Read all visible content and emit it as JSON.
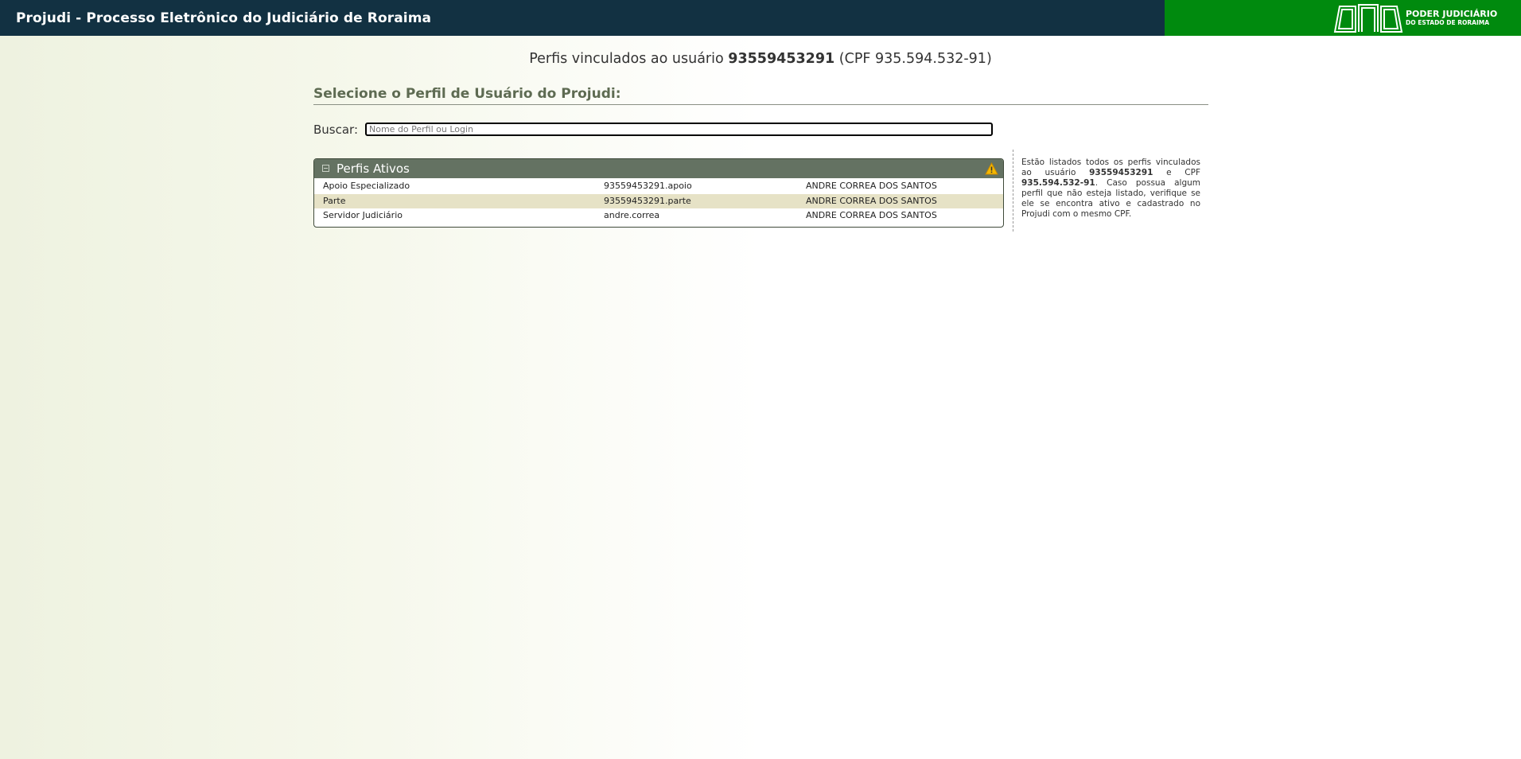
{
  "header": {
    "title": "Projudi - Processo Eletrônico do Judiciário de Roraima",
    "brand_line1": "PODER JUDICIÁRIO",
    "brand_line2": "DO ESTADO DE RORAIMA",
    "brand_color": "#008a0e",
    "bar_color": "#123142"
  },
  "heading": {
    "prefix": "Perfis vinculados ao usuário",
    "user": "93559453291",
    "cpf": "(CPF 935.594.532-91)"
  },
  "subheading": "Selecione o Perfil de Usuário do Projudi:",
  "search": {
    "label": "Buscar:",
    "placeholder": "Nome do Perfil ou Login",
    "value": ""
  },
  "panel": {
    "title": "Perfis Ativos",
    "collapse_icon": "collapse-icon",
    "warning_icon": "warning-icon",
    "header_color": "#647262",
    "rows": [
      {
        "perfil": "Apoio Especializado",
        "login": "93559453291.apoio",
        "nome": "ANDRE CORREA DOS SANTOS"
      },
      {
        "perfil": "Parte",
        "login": "93559453291.parte",
        "nome": "ANDRE CORREA DOS SANTOS"
      },
      {
        "perfil": "Servidor Judiciário",
        "login": "andre.correa",
        "nome": "ANDRE CORREA DOS SANTOS"
      }
    ]
  },
  "note": {
    "t1": "Estão listados todos os perfis vinculados ao usuário",
    "user": "93559453291",
    "t2": "e CPF",
    "cpf": "935.594.532-91",
    "t3": ". Caso possua algum perfil que não esteja listado, verifique se ele se encontra ativo e cadastrado no Projudi com o mesmo CPF."
  }
}
